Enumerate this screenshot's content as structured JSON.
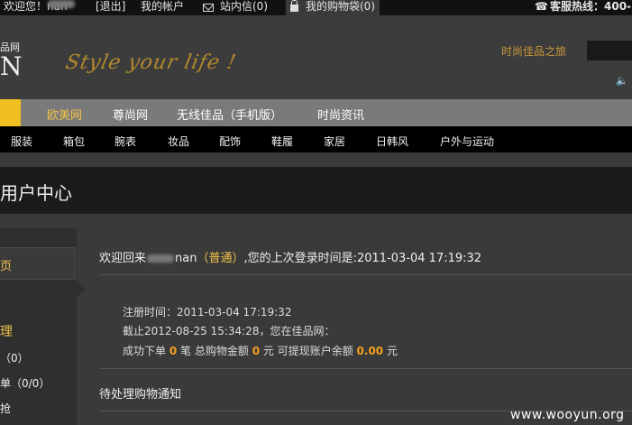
{
  "topbar": {
    "welcome_prefix": "欢迎您！",
    "username_suffix": "nan",
    "logout": "[退出]",
    "my_account": "我的帐户",
    "messages": "站内信(0)",
    "cart": "我的购物袋(0)",
    "hotline": "客服热线：400-"
  },
  "header": {
    "logo_small": "品网",
    "logo_big": "N",
    "slogan": "Style your life !",
    "tagline": "时尚佳品之旅"
  },
  "nav_primary": [
    "欧美网",
    "尊尚网",
    "无线佳品（手机版）",
    "时尚资讯"
  ],
  "nav_secondary": [
    "服装",
    "箱包",
    "腕表",
    "妆品",
    "配饰",
    "鞋履",
    "家居",
    "日韩风",
    "户外与运动"
  ],
  "page_title": "用户中心",
  "sidebar": {
    "home_tab": "页",
    "section_title": "理",
    "items": [
      "（0）",
      "单（0/0）",
      "抢"
    ]
  },
  "main": {
    "welcome_prefix": "欢迎回来",
    "username_suffix": "nan",
    "level": "（普通）",
    "last_login_text": ",您的上次登录时间是:2011-03-04 17:19:32",
    "register_time": "注册时间：2011-03-04 17:19:32",
    "as_of": "截止2012-08-25 15:34:28，您在佳品网：",
    "stat_orders_prefix": "成功下单",
    "stat_orders": "0",
    "stat_orders_unit": "笔 总购物金额",
    "stat_total": "0",
    "stat_total_unit": "元 可提现账户余额",
    "stat_balance": "0.00",
    "stat_balance_unit": "元",
    "pending_title": "待处理购物通知"
  },
  "watermark": "www.wooyun.org",
  "colors": {
    "accent_gold": "#f2c24a",
    "accent_orange": "#f2a020",
    "nav_bar": "#7a7a7a"
  }
}
